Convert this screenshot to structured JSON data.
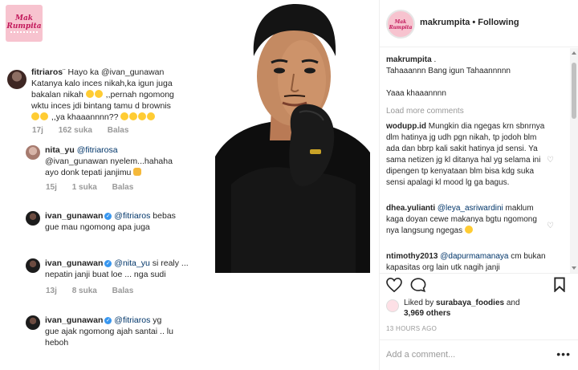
{
  "left": {
    "logo_text": "Mak Rumpita",
    "comments": [
      {
        "user": "fitriaros",
        "blur": "¨",
        "lines": [
          "Hayo ka @ivan_gunawan",
          "Katanya kalo inces nikah,ka igun juga",
          "bakalan nikah",
          ",,pernah ngomong",
          "wktu inces jdi bintang tamu d brownis",
          ",,ya khaaannnn??"
        ],
        "time": "17j",
        "likes": "162 suka",
        "reply": "Balas"
      },
      {
        "user": "nita_yu",
        "mention": "@fitriarosa",
        "lines": [
          "@ivan_gunawan nyelem...hahaha",
          "ayo donk tepati janjimu"
        ],
        "time": "15j",
        "likes": "1 suka",
        "reply": "Balas"
      },
      {
        "user": "ivan_gunawan",
        "mention": "@fitriaros",
        "lines": [
          "bebas",
          "gue mau ngomong apa juga"
        ]
      },
      {
        "user": "ivan_gunawan",
        "mention": "@nita_yu",
        "lines": [
          "si realy ...",
          "nepatin janji buat loe ... nga sudi"
        ],
        "time": "13j",
        "likes": "8 suka",
        "reply": "Balas"
      },
      {
        "user": "ivan_gunawan",
        "mention": "@fitriaros",
        "lines": [
          "yg",
          "gue ajak ngomong ajah santai .. lu",
          "heboh"
        ]
      }
    ]
  },
  "post": {
    "header": {
      "logo_text": "Mak Rumpita",
      "username": "makrumpita",
      "dot": "•",
      "follow": "Following"
    },
    "caption": {
      "user": "makrumpita",
      "suffix": ".",
      "line1": "Tahaaannn Bang igun Tahaannnnn",
      "line2": "Yaaa khaaannnn"
    },
    "load_more": "Load more comments",
    "comments": [
      {
        "user": "wodupp.id",
        "text": "Mungkin dia ngegas krn sbnrnya dlm hatinya jg udh pgn nikah, tp jodoh blm ada dan bbrp kali sakit hatinya jd sensi. Ya sama netizen jg kl ditanya hal yg selama ini dipengen tp kenyataan blm bisa kdg suka sensi apalagi kl mood lg ga bagus."
      },
      {
        "user": "dhea.yulianti",
        "mention": "@leya_asriwardini",
        "text": "maklum kaga doyan cewe makanya bgtu ngomong nya langsung ngegas"
      },
      {
        "user": "ntimothy2013",
        "mention": "@dapurmamanaya",
        "text": "cm bukan kapasitas org lain utk nagih janji"
      }
    ],
    "likes": {
      "prefix": "Liked by",
      "user": "surabaya_foodies",
      "and": "and",
      "count": "3,969 others"
    },
    "time": "13 HOURS AGO",
    "add_comment_placeholder": "Add a comment...",
    "more": "•••"
  }
}
